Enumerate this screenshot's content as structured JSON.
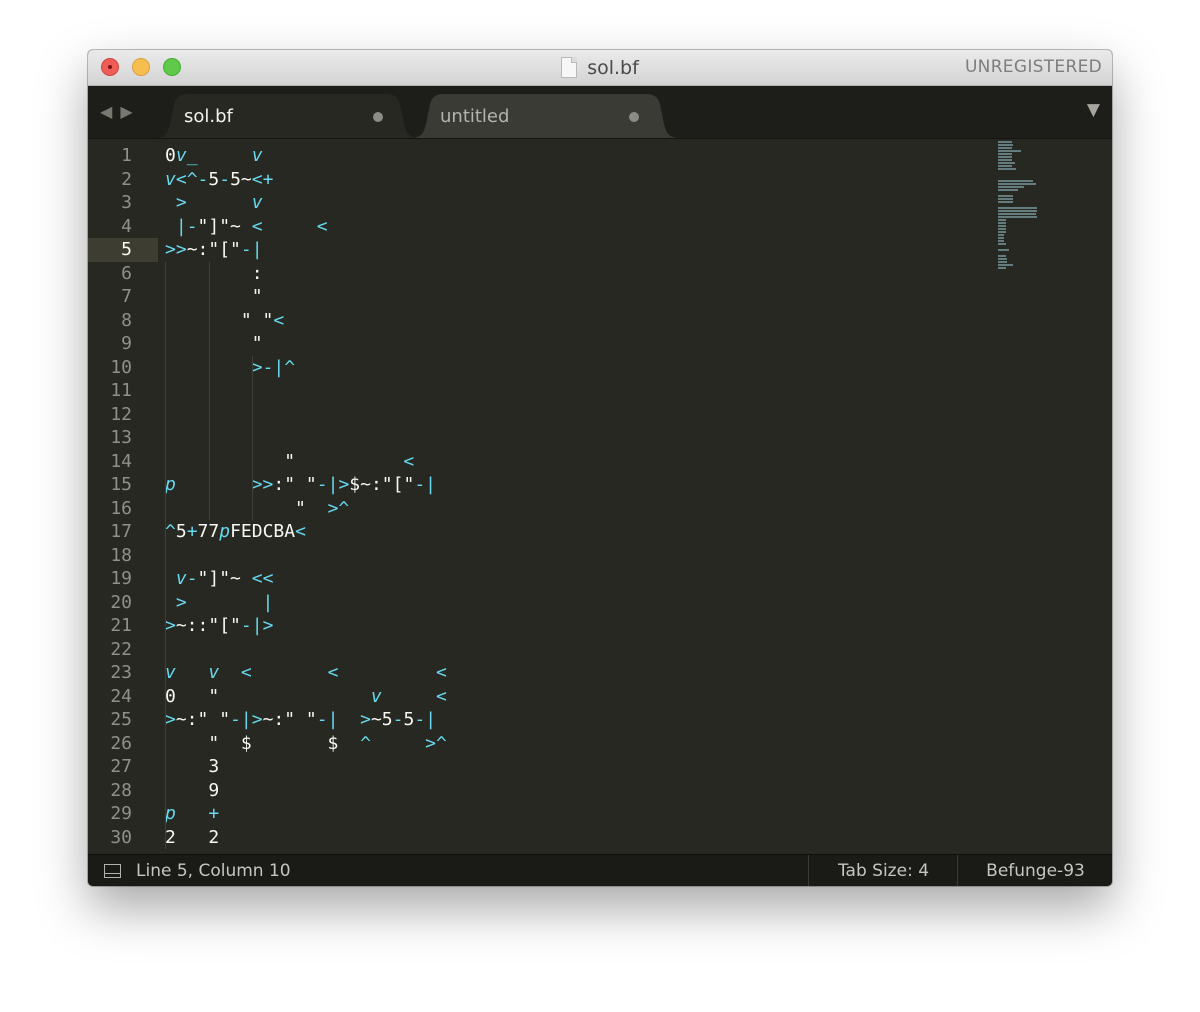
{
  "window": {
    "title": "sol.bf",
    "registration": "UNREGISTERED"
  },
  "tabs": [
    {
      "label": "sol.bf",
      "active": true,
      "modified": true
    },
    {
      "label": "untitled",
      "active": false,
      "modified": true
    }
  ],
  "icons": {
    "close": "close-icon",
    "minimize": "minimize-icon",
    "maximize": "maximize-icon",
    "nav_back": "◀",
    "nav_forward": "▶",
    "dropdown": "▼",
    "panel": "panel-toggle-icon"
  },
  "editor": {
    "active_line": 5,
    "colors": {
      "background": "#272822",
      "text": "#f8f8f2",
      "operator": "#66d9ef",
      "line_numbers": "#8f908a"
    },
    "lines": [
      "0v_     v",
      "v<^-5-5~<+",
      " >      v",
      " |-\"]\"~ <     <",
      ">>~:\"[\"-|",
      "        :",
      "        \"",
      "       \" \"<",
      "        \"",
      "        >-|^",
      "",
      "",
      "",
      "           \"          <",
      "p       >>:\" \"-|>$~:\"[\"-|",
      "            \"  >^",
      "^5+77pFEDCBA<",
      "",
      " v-\"]\"~ <<",
      " >       |",
      ">~::\"[\"-|>",
      "",
      "v   v  <       <         <",
      "0   \"              v     <",
      ">~:\" \"-|>~:\" \"-|  >~5-5-|",
      "    \"  $       $  ^     >^",
      "    3",
      "    9",
      "p   +",
      "2   2"
    ]
  },
  "status": {
    "position": "Line 5, Column 10",
    "tab_size": "Tab Size: 4",
    "syntax": "Befunge-93"
  }
}
